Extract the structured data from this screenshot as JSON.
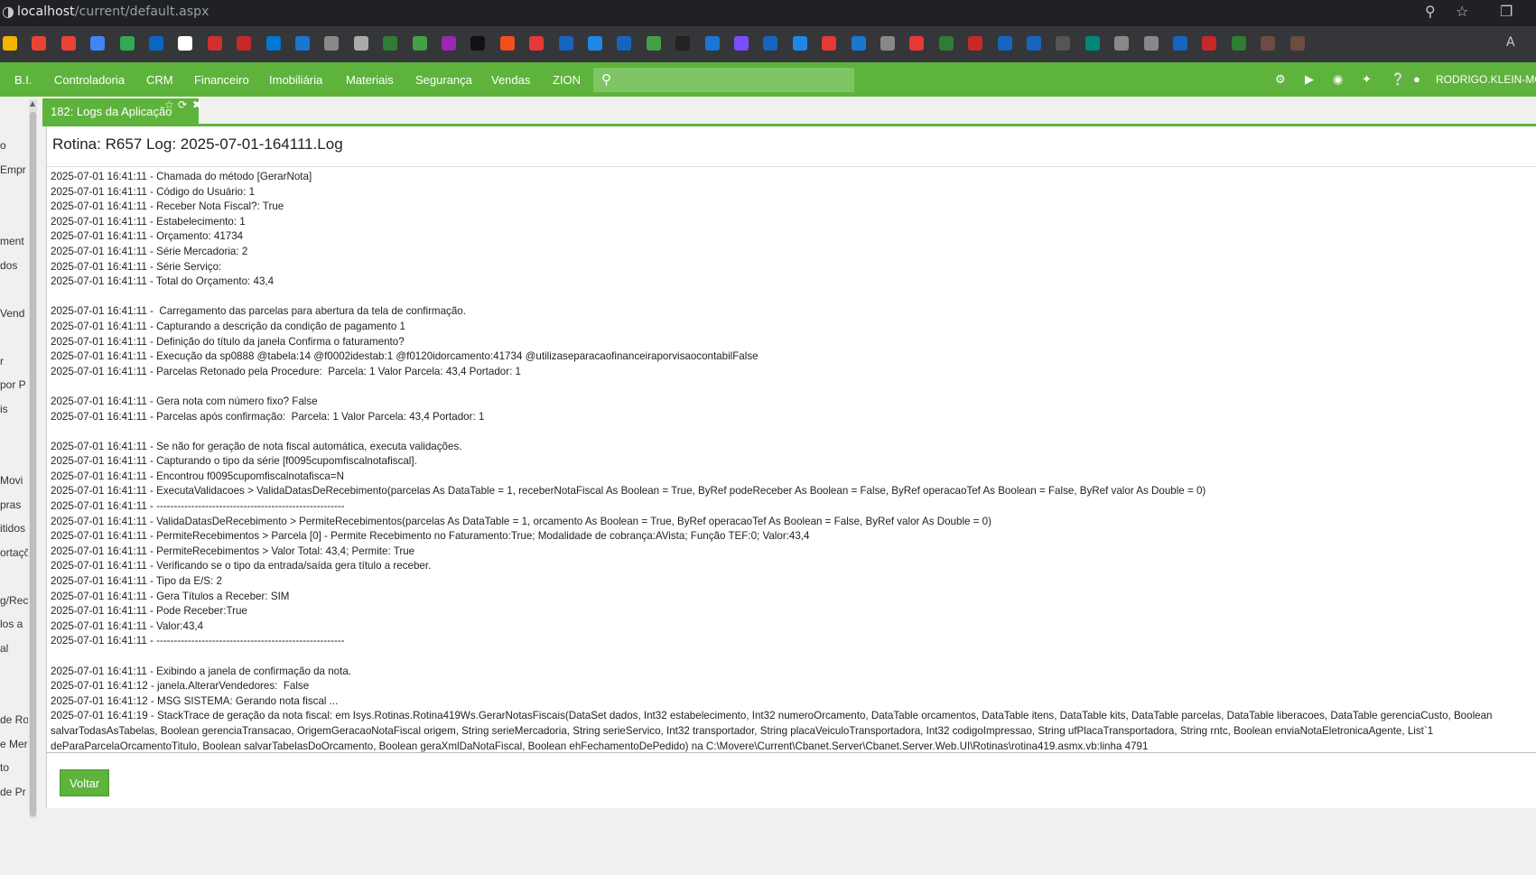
{
  "browser": {
    "url_host": "localhost",
    "url_path": "/current/default.aspx",
    "bookmarks_overflow_label": "A"
  },
  "nav": {
    "items": [
      "B.I.",
      "Controladoria",
      "CRM",
      "Financeiro",
      "Imobiliária",
      "Materiais",
      "Segurança",
      "Vendas",
      "ZION"
    ],
    "search_placeholder": "",
    "user": "RODRIGO.KLEIN-MO",
    "accent": "#5eb33c"
  },
  "left_strip": [
    "o",
    "Empr",
    "",
    "",
    "ment",
    "dos",
    "",
    "Vend",
    "",
    "r",
    "por P",
    "is",
    "",
    "",
    "Movi",
    "pras",
    "itidos",
    "ortaçõ",
    "",
    "g/Rec",
    "los a",
    "al",
    "",
    "",
    "de Ro",
    "e Mer",
    "to",
    "de Pr"
  ],
  "tab": {
    "label": "182: Logs da Aplicação"
  },
  "panel": {
    "title": "Rotina: R657 Log: 2025-07-01-164111.Log",
    "lines": [
      "2025-07-01 16:41:11 - Chamada do método [GerarNota]",
      "2025-07-01 16:41:11 - Código do Usuário: 1",
      "2025-07-01 16:41:11 - Receber Nota Fiscal?: True",
      "2025-07-01 16:41:11 - Estabelecimento: 1",
      "2025-07-01 16:41:11 - Orçamento: 41734",
      "2025-07-01 16:41:11 - Série Mercadoria: 2",
      "2025-07-01 16:41:11 - Série Serviço:",
      "2025-07-01 16:41:11 - Total do Orçamento: 43,4",
      "",
      "2025-07-01 16:41:11 -  Carregamento das parcelas para abertura da tela de confirmação.",
      "2025-07-01 16:41:11 - Capturando a descrição da condição de pagamento 1",
      "2025-07-01 16:41:11 - Definição do título da janela Confirma o faturamento?",
      "2025-07-01 16:41:11 - Execução da sp0888 @tabela:14 @f0002idestab:1 @f0120idorcamento:41734 @utilizaseparacaofinanceiraporvisaocontabilFalse",
      "2025-07-01 16:41:11 - Parcelas Retonado pela Procedure:  Parcela: 1 Valor Parcela: 43,4 Portador: 1",
      "",
      "2025-07-01 16:41:11 - Gera nota com número fixo? False",
      "2025-07-01 16:41:11 - Parcelas após confirmação:  Parcela: 1 Valor Parcela: 43,4 Portador: 1",
      "",
      "2025-07-01 16:41:11 - Se não for geração de nota fiscal automática, executa validações.",
      "2025-07-01 16:41:11 - Capturando o tipo da série [f0095cupomfiscalnotafiscal].",
      "2025-07-01 16:41:11 - Encontrou f0095cupomfiscalnotafisca=N",
      "2025-07-01 16:41:11 - ExecutaValidacoes > ValidaDatasDeRecebimento(parcelas As DataTable = 1, receberNotaFiscal As Boolean = True, ByRef podeReceber As Boolean = False, ByRef operacaoTef As Boolean = False, ByRef valor As Double = 0)",
      "2025-07-01 16:41:11 - ------------------------------------------------------",
      "2025-07-01 16:41:11 - ValidaDatasDeRecebimento > PermiteRecebimentos(parcelas As DataTable = 1, orcamento As Boolean = True, ByRef operacaoTef As Boolean = False, ByRef valor As Double = 0)",
      "2025-07-01 16:41:11 - PermiteRecebimentos > Parcela [0] - Permite Recebimento no Faturamento:True; Modalidade de cobrança:AVista; Função TEF:0; Valor:43,4",
      "2025-07-01 16:41:11 - PermiteRecebimentos > Valor Total: 43,4; Permite: True",
      "2025-07-01 16:41:11 - Verificando se o tipo da entrada/saída gera título a receber.",
      "2025-07-01 16:41:11 - Tipo da E/S: 2",
      "2025-07-01 16:41:11 - Gera Títulos a Receber: SIM",
      "2025-07-01 16:41:11 - Pode Receber:True",
      "2025-07-01 16:41:11 - Valor:43,4",
      "2025-07-01 16:41:11 - ------------------------------------------------------",
      "",
      "2025-07-01 16:41:11 - Exibindo a janela de confirmação da nota.",
      "2025-07-01 16:41:12 - janela.AlterarVendedores:  False",
      "2025-07-01 16:41:12 - MSG SISTEMA: Gerando nota fiscal ..."
    ],
    "stacktrace": "2025-07-01 16:41:19 - StackTrace de geração da nota fiscal:     em Isys.Rotinas.Rotina419Ws.GerarNotasFiscais(DataSet dados, Int32 estabelecimento, Int32 numeroOrcamento, DataTable orcamentos, DataTable itens, DataTable kits, DataTable parcelas, DataTable liberacoes, DataTable gerenciaCusto, Boolean salvarTodasAsTabelas, Boolean gerenciaTransacao, OrigemGeracaoNotaFiscal origem, String serieMercadoria, String serieServico, Int32 transportador, String placaVeiculoTransportadora, Int32 codigoImpressao, String ufPlacaTransportadora, String rntc, Boolean enviaNotaEletronicaAgente, List`1 deParaParcelaOrcamentoTitulo, Boolean salvarTabelasDoOrcamento, Boolean geraXmlDaNotaFiscal, Boolean ehFechamentoDePedido) na C:\\Movere\\Current\\Cbanet.Server\\Cbanet.Server.Web.UI\\Rotinas\\rotina419.asmx.vb:linha 4791",
    "back_button": "Voltar"
  }
}
